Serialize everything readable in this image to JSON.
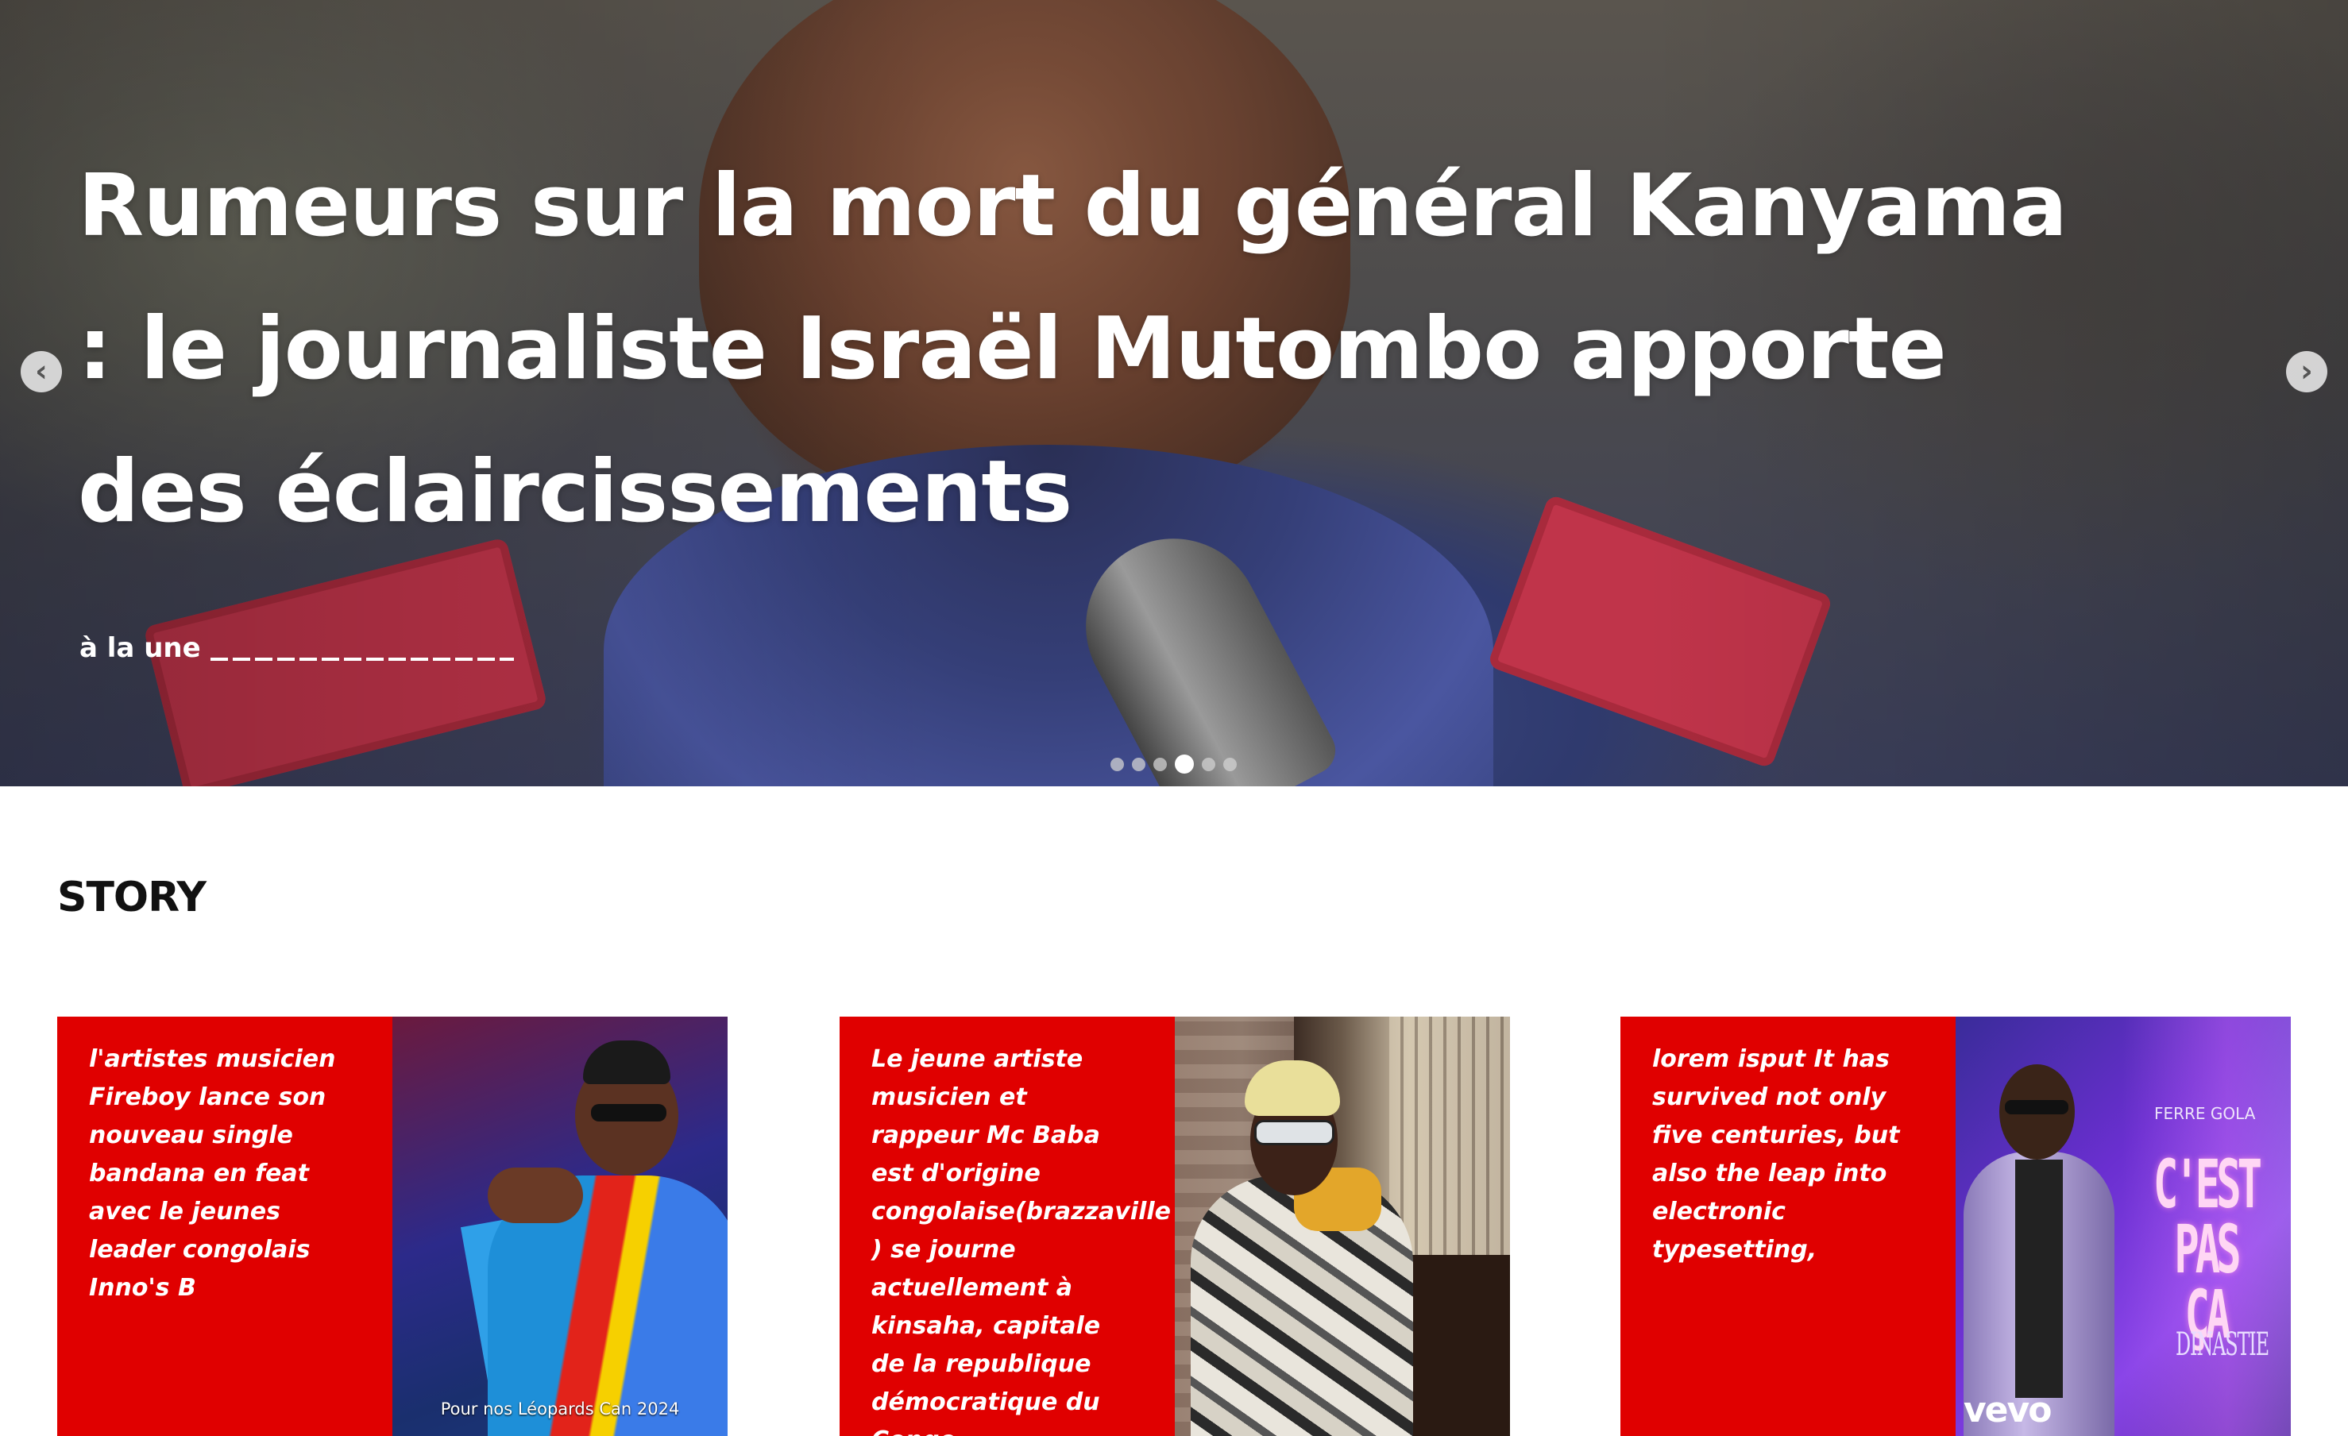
{
  "hero": {
    "title": "Rumeurs sur la mort du général Kanyama : le journaliste Israël Mutombo apporte des éclaircissements",
    "category": "à la une",
    "prev_icon": "chevron-left-icon",
    "next_icon": "chevron-right-icon",
    "slide_count": 6,
    "active_slide": 4
  },
  "story": {
    "heading": "STORY",
    "cards": [
      {
        "text": "l'artistes musicien Fireboy lance son nouveau single bandana en feat avec le jeunes leader congolais Inno's B",
        "thumb_caption": "Pour nos Léopards Can 2024"
      },
      {
        "text": "Le jeune artiste musicien et rappeur Mc Baba est d'origine congolaise(brazzaville ) se journe actuellement à kinsaha, capitale de la republique démocratique du Congo"
      },
      {
        "text": "lorem isput It has survived not only five centuries, but also the leap into electronic typesetting,",
        "thumb_big": "C'EST PAS ÇA",
        "thumb_sub": "DINASTIE",
        "thumb_brand": "FERRE GOLA",
        "thumb_logo": "vevo"
      }
    ]
  },
  "colors": {
    "card_red": "#e00000",
    "text_white": "#ffffff",
    "heading_black": "#111111"
  }
}
